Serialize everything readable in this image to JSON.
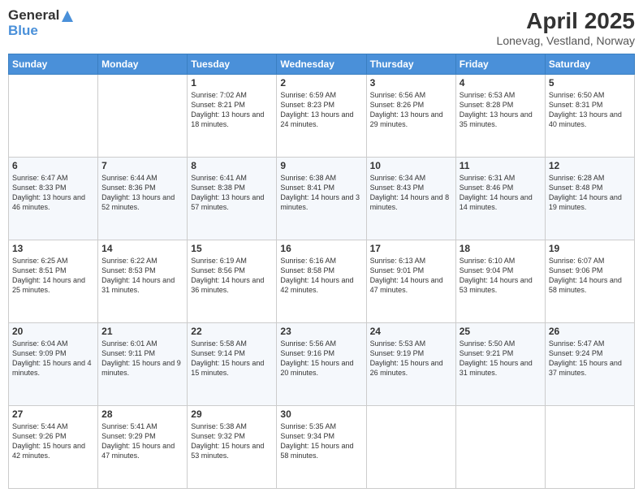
{
  "logo": {
    "line1": "General",
    "line2": "Blue"
  },
  "title": "April 2025",
  "subtitle": "Lonevag, Vestland, Norway",
  "weekdays": [
    "Sunday",
    "Monday",
    "Tuesday",
    "Wednesday",
    "Thursday",
    "Friday",
    "Saturday"
  ],
  "weeks": [
    [
      {
        "day": "",
        "info": ""
      },
      {
        "day": "",
        "info": ""
      },
      {
        "day": "1",
        "info": "Sunrise: 7:02 AM\nSunset: 8:21 PM\nDaylight: 13 hours and 18 minutes."
      },
      {
        "day": "2",
        "info": "Sunrise: 6:59 AM\nSunset: 8:23 PM\nDaylight: 13 hours and 24 minutes."
      },
      {
        "day": "3",
        "info": "Sunrise: 6:56 AM\nSunset: 8:26 PM\nDaylight: 13 hours and 29 minutes."
      },
      {
        "day": "4",
        "info": "Sunrise: 6:53 AM\nSunset: 8:28 PM\nDaylight: 13 hours and 35 minutes."
      },
      {
        "day": "5",
        "info": "Sunrise: 6:50 AM\nSunset: 8:31 PM\nDaylight: 13 hours and 40 minutes."
      }
    ],
    [
      {
        "day": "6",
        "info": "Sunrise: 6:47 AM\nSunset: 8:33 PM\nDaylight: 13 hours and 46 minutes."
      },
      {
        "day": "7",
        "info": "Sunrise: 6:44 AM\nSunset: 8:36 PM\nDaylight: 13 hours and 52 minutes."
      },
      {
        "day": "8",
        "info": "Sunrise: 6:41 AM\nSunset: 8:38 PM\nDaylight: 13 hours and 57 minutes."
      },
      {
        "day": "9",
        "info": "Sunrise: 6:38 AM\nSunset: 8:41 PM\nDaylight: 14 hours and 3 minutes."
      },
      {
        "day": "10",
        "info": "Sunrise: 6:34 AM\nSunset: 8:43 PM\nDaylight: 14 hours and 8 minutes."
      },
      {
        "day": "11",
        "info": "Sunrise: 6:31 AM\nSunset: 8:46 PM\nDaylight: 14 hours and 14 minutes."
      },
      {
        "day": "12",
        "info": "Sunrise: 6:28 AM\nSunset: 8:48 PM\nDaylight: 14 hours and 19 minutes."
      }
    ],
    [
      {
        "day": "13",
        "info": "Sunrise: 6:25 AM\nSunset: 8:51 PM\nDaylight: 14 hours and 25 minutes."
      },
      {
        "day": "14",
        "info": "Sunrise: 6:22 AM\nSunset: 8:53 PM\nDaylight: 14 hours and 31 minutes."
      },
      {
        "day": "15",
        "info": "Sunrise: 6:19 AM\nSunset: 8:56 PM\nDaylight: 14 hours and 36 minutes."
      },
      {
        "day": "16",
        "info": "Sunrise: 6:16 AM\nSunset: 8:58 PM\nDaylight: 14 hours and 42 minutes."
      },
      {
        "day": "17",
        "info": "Sunrise: 6:13 AM\nSunset: 9:01 PM\nDaylight: 14 hours and 47 minutes."
      },
      {
        "day": "18",
        "info": "Sunrise: 6:10 AM\nSunset: 9:04 PM\nDaylight: 14 hours and 53 minutes."
      },
      {
        "day": "19",
        "info": "Sunrise: 6:07 AM\nSunset: 9:06 PM\nDaylight: 14 hours and 58 minutes."
      }
    ],
    [
      {
        "day": "20",
        "info": "Sunrise: 6:04 AM\nSunset: 9:09 PM\nDaylight: 15 hours and 4 minutes."
      },
      {
        "day": "21",
        "info": "Sunrise: 6:01 AM\nSunset: 9:11 PM\nDaylight: 15 hours and 9 minutes."
      },
      {
        "day": "22",
        "info": "Sunrise: 5:58 AM\nSunset: 9:14 PM\nDaylight: 15 hours and 15 minutes."
      },
      {
        "day": "23",
        "info": "Sunrise: 5:56 AM\nSunset: 9:16 PM\nDaylight: 15 hours and 20 minutes."
      },
      {
        "day": "24",
        "info": "Sunrise: 5:53 AM\nSunset: 9:19 PM\nDaylight: 15 hours and 26 minutes."
      },
      {
        "day": "25",
        "info": "Sunrise: 5:50 AM\nSunset: 9:21 PM\nDaylight: 15 hours and 31 minutes."
      },
      {
        "day": "26",
        "info": "Sunrise: 5:47 AM\nSunset: 9:24 PM\nDaylight: 15 hours and 37 minutes."
      }
    ],
    [
      {
        "day": "27",
        "info": "Sunrise: 5:44 AM\nSunset: 9:26 PM\nDaylight: 15 hours and 42 minutes."
      },
      {
        "day": "28",
        "info": "Sunrise: 5:41 AM\nSunset: 9:29 PM\nDaylight: 15 hours and 47 minutes."
      },
      {
        "day": "29",
        "info": "Sunrise: 5:38 AM\nSunset: 9:32 PM\nDaylight: 15 hours and 53 minutes."
      },
      {
        "day": "30",
        "info": "Sunrise: 5:35 AM\nSunset: 9:34 PM\nDaylight: 15 hours and 58 minutes."
      },
      {
        "day": "",
        "info": ""
      },
      {
        "day": "",
        "info": ""
      },
      {
        "day": "",
        "info": ""
      }
    ]
  ]
}
